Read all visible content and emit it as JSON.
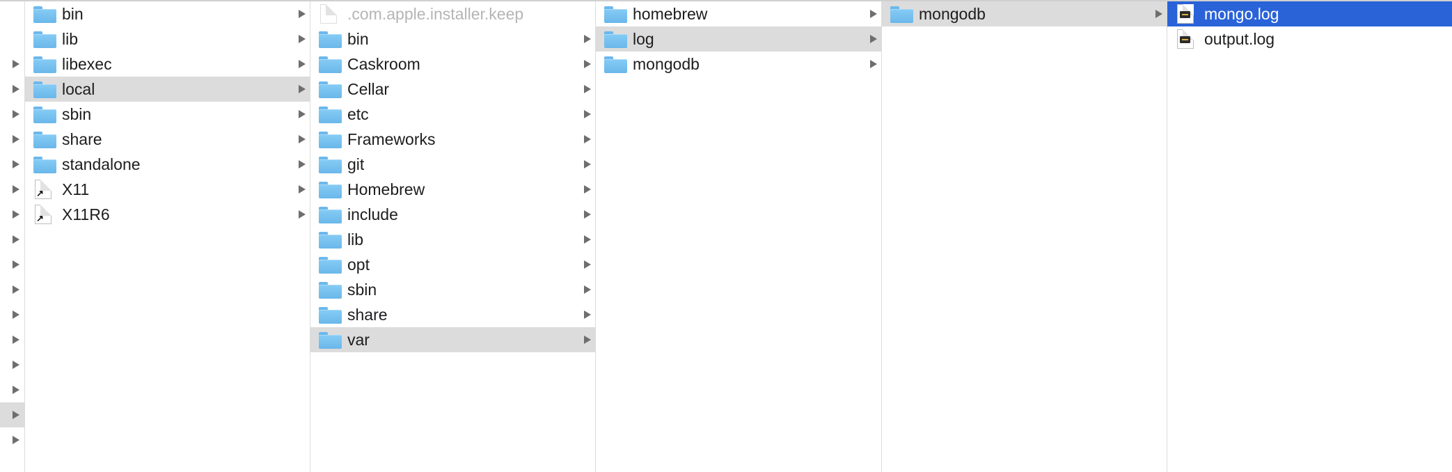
{
  "edge_strip": {
    "selected_index": 16,
    "rows": 18
  },
  "columns": [
    {
      "items": [
        {
          "name": "bin",
          "icon": "folder-icon",
          "arrow": true
        },
        {
          "name": "lib",
          "icon": "folder-icon",
          "arrow": true
        },
        {
          "name": "libexec",
          "icon": "folder-icon",
          "arrow": true
        },
        {
          "name": "local",
          "icon": "folder-icon",
          "arrow": true,
          "selected": "gray"
        },
        {
          "name": "sbin",
          "icon": "folder-icon",
          "arrow": true
        },
        {
          "name": "share",
          "icon": "folder-icon",
          "arrow": true
        },
        {
          "name": "standalone",
          "icon": "folder-icon",
          "arrow": true
        },
        {
          "name": "X11",
          "icon": "alias-icon",
          "arrow": true
        },
        {
          "name": "X11R6",
          "icon": "alias-icon",
          "arrow": true
        }
      ]
    },
    {
      "items": [
        {
          "name": ".com.apple.installer.keep",
          "icon": "document-icon",
          "arrow": false,
          "dim": true
        },
        {
          "name": "bin",
          "icon": "folder-icon",
          "arrow": true
        },
        {
          "name": "Caskroom",
          "icon": "folder-icon",
          "arrow": true
        },
        {
          "name": "Cellar",
          "icon": "folder-icon",
          "arrow": true
        },
        {
          "name": "etc",
          "icon": "folder-icon",
          "arrow": true
        },
        {
          "name": "Frameworks",
          "icon": "folder-icon",
          "arrow": true
        },
        {
          "name": "git",
          "icon": "folder-icon",
          "arrow": true
        },
        {
          "name": "Homebrew",
          "icon": "folder-icon",
          "arrow": true
        },
        {
          "name": "include",
          "icon": "folder-icon",
          "arrow": true
        },
        {
          "name": "lib",
          "icon": "folder-icon",
          "arrow": true
        },
        {
          "name": "opt",
          "icon": "folder-icon",
          "arrow": true
        },
        {
          "name": "sbin",
          "icon": "folder-icon",
          "arrow": true
        },
        {
          "name": "share",
          "icon": "folder-icon",
          "arrow": true
        },
        {
          "name": "var",
          "icon": "folder-icon",
          "arrow": true,
          "selected": "gray"
        }
      ]
    },
    {
      "items": [
        {
          "name": "homebrew",
          "icon": "folder-icon",
          "arrow": true
        },
        {
          "name": "log",
          "icon": "folder-icon",
          "arrow": true,
          "selected": "gray"
        },
        {
          "name": "mongodb",
          "icon": "folder-icon",
          "arrow": true
        }
      ]
    },
    {
      "items": [
        {
          "name": "mongodb",
          "icon": "folder-icon",
          "arrow": true,
          "selected": "gray"
        }
      ]
    },
    {
      "items": [
        {
          "name": "mongo.log",
          "icon": "log-file-icon",
          "arrow": false,
          "selected": "blue"
        },
        {
          "name": "output.log",
          "icon": "log-file-icon",
          "arrow": false
        }
      ]
    }
  ],
  "colors": {
    "selection_blue": "#2a62d8",
    "selection_gray": "#dcdcdc",
    "folder": "#7cc2f0"
  }
}
